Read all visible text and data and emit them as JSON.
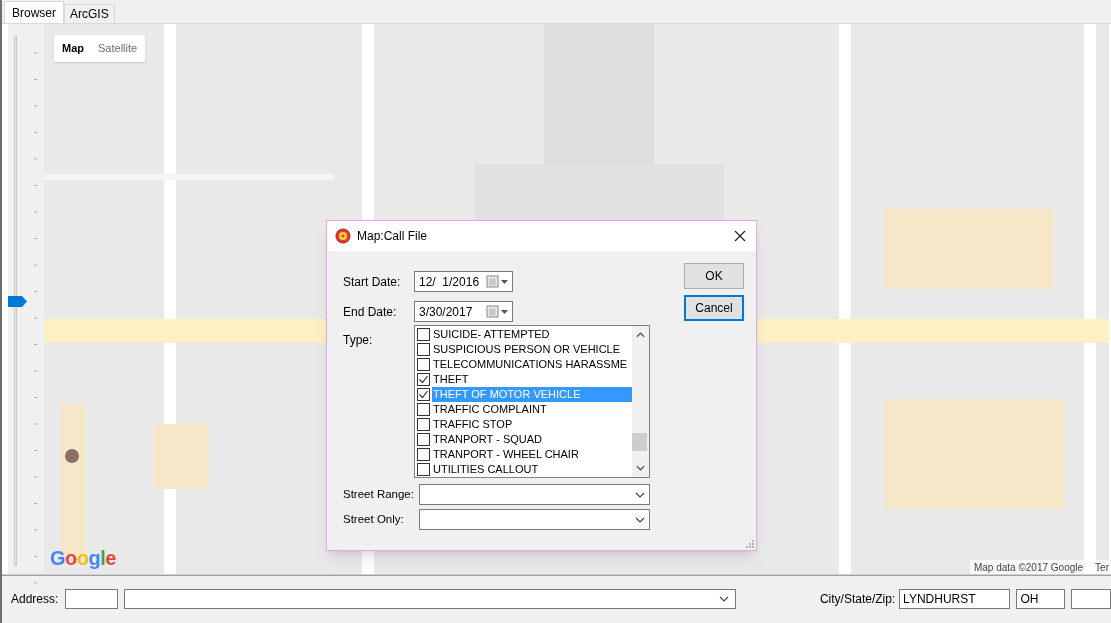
{
  "tabs": [
    {
      "label": "Browser",
      "selected": true
    },
    {
      "label": "ArcGIS",
      "selected": false
    }
  ],
  "map": {
    "map_type": [
      {
        "label": "Map",
        "selected": true
      },
      {
        "label": "Satellite",
        "selected": false
      }
    ],
    "zoom": {
      "level": 0.5
    },
    "logo": "Google",
    "attribution": "Map data ©2017 Google",
    "terms": "Ter"
  },
  "dialog": {
    "title": "Map:Call File",
    "start_date": {
      "label": "Start Date:",
      "value": "12/  1/2016"
    },
    "end_date": {
      "label": "End Date:",
      "value": "3/30/2017"
    },
    "type": {
      "label": "Type:",
      "items": [
        {
          "label": "SUICIDE- ATTEMPTED",
          "checked": false,
          "selected": false
        },
        {
          "label": "SUSPICIOUS PERSON OR VEHICLE",
          "checked": false,
          "selected": false
        },
        {
          "label": "TELECOMMUNICATIONS HARASSME",
          "checked": false,
          "selected": false
        },
        {
          "label": "THEFT",
          "checked": true,
          "selected": false
        },
        {
          "label": "THEFT OF MOTOR VEHICLE",
          "checked": true,
          "selected": true
        },
        {
          "label": "TRAFFIC COMPLAINT",
          "checked": false,
          "selected": false
        },
        {
          "label": "TRAFFIC STOP",
          "checked": false,
          "selected": false
        },
        {
          "label": "TRANPORT - SQUAD",
          "checked": false,
          "selected": false
        },
        {
          "label": "TRANPORT - WHEEL CHAIR",
          "checked": false,
          "selected": false
        },
        {
          "label": "UTILITIES CALLOUT",
          "checked": false,
          "selected": false
        }
      ]
    },
    "street_range": {
      "label": "Street Range:"
    },
    "street_only": {
      "label": "Street Only:"
    },
    "buttons": [
      {
        "label": "OK",
        "default": false
      },
      {
        "label": "Cancel",
        "default": true
      }
    ]
  },
  "address_bar": {
    "address_label": "Address:",
    "city_label": "City/State/Zip:",
    "city": "LYNDHURST",
    "state": "OH"
  }
}
